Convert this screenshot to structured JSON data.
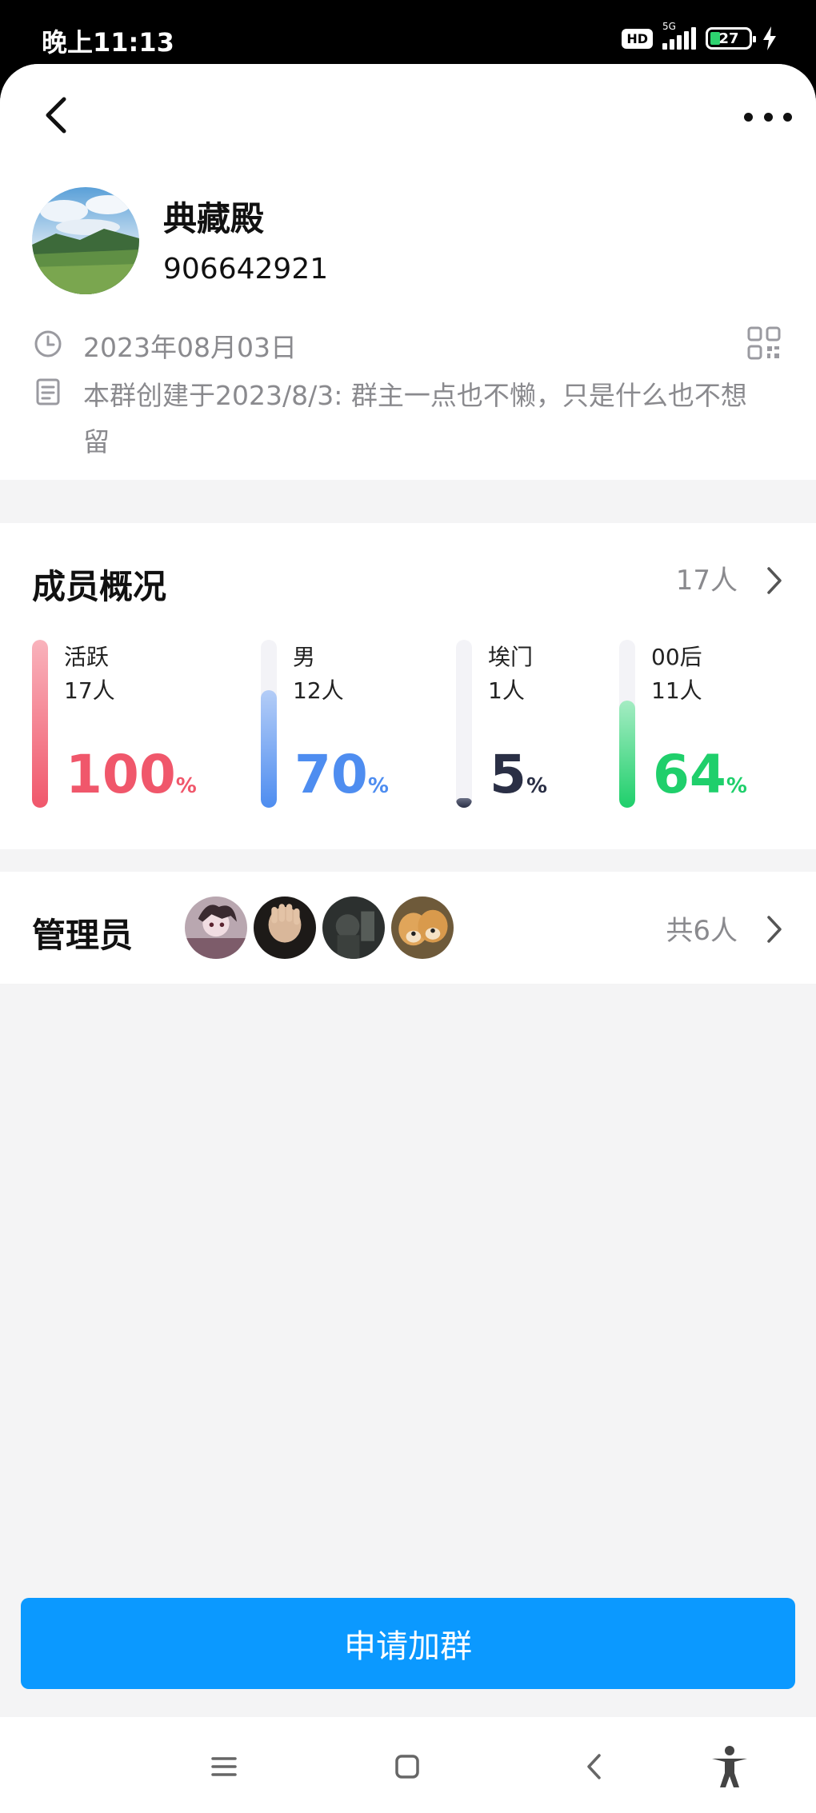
{
  "status_bar": {
    "time": "晚上11:13",
    "hd": "HD",
    "network": "5G",
    "battery": "27"
  },
  "group": {
    "name": "典藏殿",
    "id": "906642921",
    "date": "2023年08月03日",
    "description": "本群创建于2023/8/3: 群主一点也不懒，只是什么也不想留"
  },
  "members": {
    "title": "成员概况",
    "count": "17人",
    "stats": [
      {
        "label": "活跃",
        "count": "17人",
        "percent": "100",
        "value": 1.0,
        "color": "#f0576b",
        "fill_top": "#f9b3bc"
      },
      {
        "label": "男",
        "count": "12人",
        "percent": "70",
        "value": 0.7,
        "color": "#4e8df0",
        "fill_top": "#b4cdf7"
      },
      {
        "label": "埃门",
        "count": "1人",
        "percent": "5",
        "value": 0.05,
        "color": "#2a2f45",
        "fill_top": "#6a6f85"
      },
      {
        "label": "00后",
        "count": "11人",
        "percent": "64",
        "value": 0.64,
        "color": "#1fcf6b",
        "fill_top": "#a5ecc3"
      }
    ],
    "percent_unit": "%"
  },
  "admins": {
    "title": "管理员",
    "count": "共6人",
    "avatars": [
      "admin-avatar-1",
      "admin-avatar-2",
      "admin-avatar-3",
      "admin-avatar-4"
    ]
  },
  "join_button": "申请加群",
  "nav": [
    "menu-icon",
    "home-icon",
    "back-icon",
    "accessibility-icon"
  ]
}
